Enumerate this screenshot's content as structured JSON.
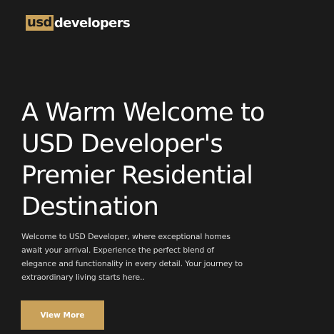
{
  "brand": {
    "logo_mark": "usd",
    "logo_text": "developers",
    "accent": "#c9a15a"
  },
  "hero": {
    "title_lines": [
      "A Warm Welcome to",
      "USD Developer's",
      "Premier Residential",
      "Destination"
    ],
    "description_lines": [
      "Welcome to USD Developer, where exceptional homes",
      "await your arrival. Experience the perfect blend of",
      "elegance and functionality in every detail. Your journey to",
      "extraordinary living starts here.."
    ],
    "cta_label": "View More"
  },
  "colors": {
    "background": "#1b1b1b",
    "text": "#ffffff"
  }
}
